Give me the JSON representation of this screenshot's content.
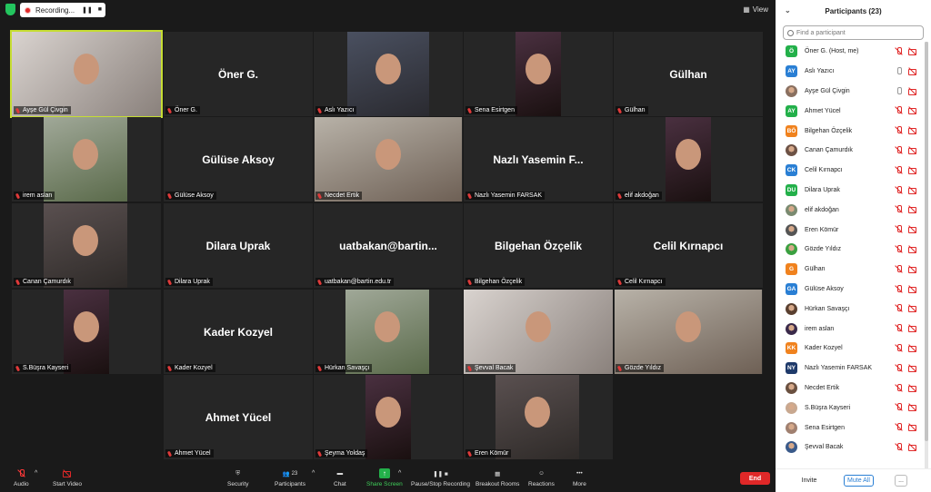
{
  "recording": {
    "label": "Recording..."
  },
  "view_label": "View",
  "tiles": [
    {
      "label": "Ayşe Gül Çivgin",
      "center": "",
      "photo": true,
      "active": true
    },
    {
      "label": "Öner G.",
      "center": "Öner G.",
      "photo": false
    },
    {
      "label": "Aslı Yazıcı",
      "center": "",
      "photo": true
    },
    {
      "label": "Sena Esirtgen",
      "center": "",
      "photo": true
    },
    {
      "label": "Gülhan",
      "center": "Gülhan",
      "photo": false
    },
    {
      "label": "irem aslan",
      "center": "",
      "photo": true
    },
    {
      "label": "Gülüse Aksoy",
      "center": "Gülüse Aksoy",
      "photo": false
    },
    {
      "label": "Necdet Ertik",
      "center": "",
      "photo": true
    },
    {
      "label": "Nazlı Yasemin FARSAK",
      "center": "Nazlı Yasemin F...",
      "photo": false
    },
    {
      "label": "elif akdoğan",
      "center": "",
      "photo": true
    },
    {
      "label": "Canan Çamurdık",
      "center": "",
      "photo": true
    },
    {
      "label": "Dilara Uprak",
      "center": "Dilara Uprak",
      "photo": false
    },
    {
      "label": "uatbakan@bartin.edu.tr",
      "center": "uatbakan@bartin...",
      "photo": false
    },
    {
      "label": "Bilgehan Özçelik",
      "center": "Bilgehan Özçelik",
      "photo": false
    },
    {
      "label": "Celil Kırnapcı",
      "center": "Celil Kırnapcı",
      "photo": false
    },
    {
      "label": "S.Büşra Kayseri",
      "center": "",
      "photo": true
    },
    {
      "label": "Kader Kozyel",
      "center": "Kader Kozyel",
      "photo": false
    },
    {
      "label": "Hürkan Savaşçı",
      "center": "",
      "photo": true
    },
    {
      "label": "Şevval Bacak",
      "center": "",
      "photo": true
    },
    {
      "label": "Gözde Yıldız",
      "center": "",
      "photo": true
    },
    {
      "label": "Ahmet Yücel",
      "center": "Ahmet Yücel",
      "photo": false
    },
    {
      "label": "Şeyma Yoldaş",
      "center": "",
      "photo": true
    },
    {
      "label": "Eren Kömür",
      "center": "",
      "photo": true
    }
  ],
  "toolbar": {
    "audio": "Audio",
    "video": "Start Video",
    "security": "Security",
    "participants": "Participants",
    "participants_count": "23",
    "chat": "Chat",
    "share": "Share Screen",
    "record": "Pause/Stop Recording",
    "breakout": "Breakout Rooms",
    "reactions": "Reactions",
    "more": "More",
    "end": "End"
  },
  "panel": {
    "title": "Participants (23)",
    "search_placeholder": "Find a participant",
    "participants": [
      {
        "name": "Öner G. (Host, me)",
        "initials": "Ö",
        "color": "#23b04a",
        "mic": "off",
        "photo": false
      },
      {
        "name": "Aslı Yazıcı",
        "initials": "AY",
        "color": "#2a7fd4",
        "mic": "on",
        "photo": false
      },
      {
        "name": "Ayşe Gül Çivgin",
        "initials": "",
        "color": "#8a7060",
        "mic": "on",
        "photo": true
      },
      {
        "name": "Ahmet Yücel",
        "initials": "AY",
        "color": "#23b04a",
        "mic": "off",
        "photo": false
      },
      {
        "name": "Bilgehan Özçelik",
        "initials": "BÖ",
        "color": "#f0821e",
        "mic": "off",
        "photo": false
      },
      {
        "name": "Canan Çamurdık",
        "initials": "",
        "color": "#6d5245",
        "mic": "off",
        "photo": true
      },
      {
        "name": "Celil Kırnapcı",
        "initials": "CK",
        "color": "#2a7fd4",
        "mic": "off",
        "photo": false
      },
      {
        "name": "Dilara Uprak",
        "initials": "DU",
        "color": "#23b04a",
        "mic": "off",
        "photo": false
      },
      {
        "name": "elif akdoğan",
        "initials": "",
        "color": "#7a8a70",
        "mic": "off",
        "photo": true
      },
      {
        "name": "Eren Kömür",
        "initials": "",
        "color": "#555",
        "mic": "off",
        "photo": true
      },
      {
        "name": "Gözde Yıldız",
        "initials": "",
        "color": "#3aa040",
        "mic": "off",
        "photo": true
      },
      {
        "name": "Gülhan",
        "initials": "G",
        "color": "#f0821e",
        "mic": "off",
        "photo": false
      },
      {
        "name": "Gülüse Aksoy",
        "initials": "GA",
        "color": "#2a7fd4",
        "mic": "off",
        "photo": false
      },
      {
        "name": "Hürkan Savaşçı",
        "initials": "",
        "color": "#5a4030",
        "mic": "off",
        "photo": true
      },
      {
        "name": "irem aslan",
        "initials": "",
        "color": "#3a2a4a",
        "mic": "off",
        "photo": true
      },
      {
        "name": "Kader Kozyel",
        "initials": "KK",
        "color": "#f0821e",
        "mic": "off",
        "photo": false
      },
      {
        "name": "Nazlı Yasemin FARSAK",
        "initials": "NY",
        "color": "#1f3a6a",
        "mic": "off",
        "photo": false
      },
      {
        "name": "Necdet Ertik",
        "initials": "",
        "color": "#6a5040",
        "mic": "off",
        "photo": true
      },
      {
        "name": "S.Büşra Kayseri",
        "initials": "",
        "color": "#c8a890",
        "mic": "off",
        "photo": true
      },
      {
        "name": "Sena Esirtgen",
        "initials": "",
        "color": "#a08070",
        "mic": "off",
        "photo": true
      },
      {
        "name": "Şevval Bacak",
        "initials": "",
        "color": "#3a5a8a",
        "mic": "off",
        "photo": true
      }
    ],
    "invite": "Invite",
    "mute_all": "Mute All",
    "more": "..."
  }
}
